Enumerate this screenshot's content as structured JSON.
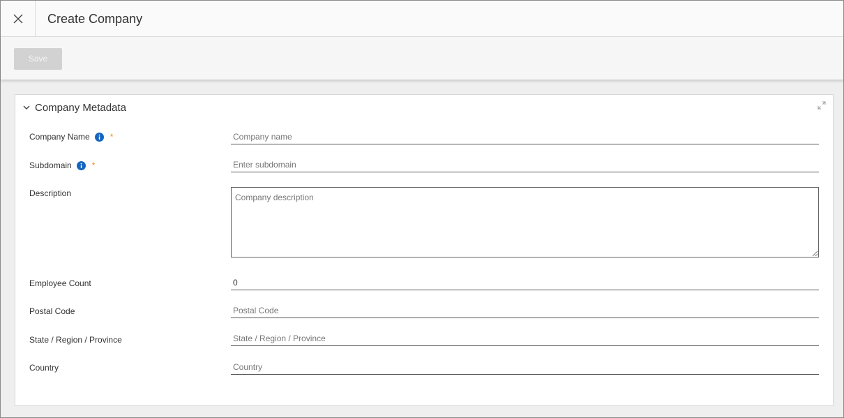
{
  "header": {
    "title": "Create Company"
  },
  "toolbar": {
    "save_label": "Save"
  },
  "panel": {
    "title": "Company Metadata",
    "fields": {
      "company_name": {
        "label": "Company Name",
        "required": "*",
        "placeholder": "Company name",
        "value": ""
      },
      "subdomain": {
        "label": "Subdomain",
        "required": "*",
        "placeholder": "Enter subdomain",
        "value": ""
      },
      "description": {
        "label": "Description",
        "placeholder": "Company description",
        "value": ""
      },
      "employee_count": {
        "label": "Employee Count",
        "placeholder": "",
        "value": "0"
      },
      "postal_code": {
        "label": "Postal Code",
        "placeholder": "Postal Code",
        "value": ""
      },
      "state": {
        "label": "State / Region / Province",
        "placeholder": "State / Region / Province",
        "value": ""
      },
      "country": {
        "label": "Country",
        "placeholder": "Country",
        "value": ""
      }
    }
  },
  "colors": {
    "info_icon": "#1565c0",
    "required_asterisk": "#f08a24",
    "save_disabled_bg": "#d2d2d2"
  },
  "icons": [
    "close-icon",
    "chevron-down-icon",
    "expand-icon",
    "info-icon"
  ]
}
